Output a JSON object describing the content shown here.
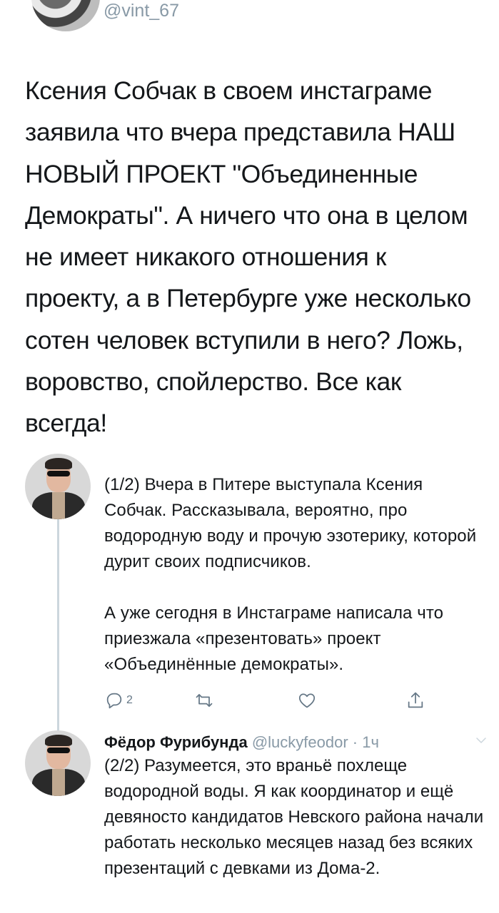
{
  "header": {
    "handle": "@vint_67"
  },
  "main_tweet": {
    "text": "Ксения Собчак в своем инстаграме заявила что вчера представила НАШ НОВЫЙ ПРОЕКТ \"Объединенные Демократы\". А ничего что она в целом не имеет никакого отношения к проекту, а в Петербурге уже несколько сотен человек вступили в него? Ложь, воровство, спойлерство. Все как всегда!"
  },
  "thread": {
    "tweet1": {
      "paragraph1": "(1/2) Вчера в Питере выступала Ксения Собчак. Рассказывала, вероятно, про водородную воду и прочую эзотерику, которой дурит своих подписчиков.",
      "paragraph2": "А уже сегодня в Инстаграме написала что приезжала «презентовать» проект «Объединённые демократы».",
      "actions": {
        "reply_count": "2"
      }
    },
    "tweet2": {
      "author_name": "Фёдор Фурибунда",
      "author_handle": "@luckyfeodor",
      "separator": "·",
      "time": "1ч",
      "text": "(2/2) Разумеется, это враньё похлеще водородной воды. Я как координатор и ещё девяносто кандидатов Невского района начали работать несколько месяцев назад без всяких презентаций с девками из Дома-2."
    }
  },
  "icons": {
    "reply": "reply-icon",
    "retweet": "retweet-icon",
    "like": "heart-icon",
    "share": "share-icon",
    "chevron": "chevron-down-icon"
  },
  "colors": {
    "text": "#14171a",
    "muted": "#8899a6",
    "thread_line": "#ccd6dd"
  }
}
